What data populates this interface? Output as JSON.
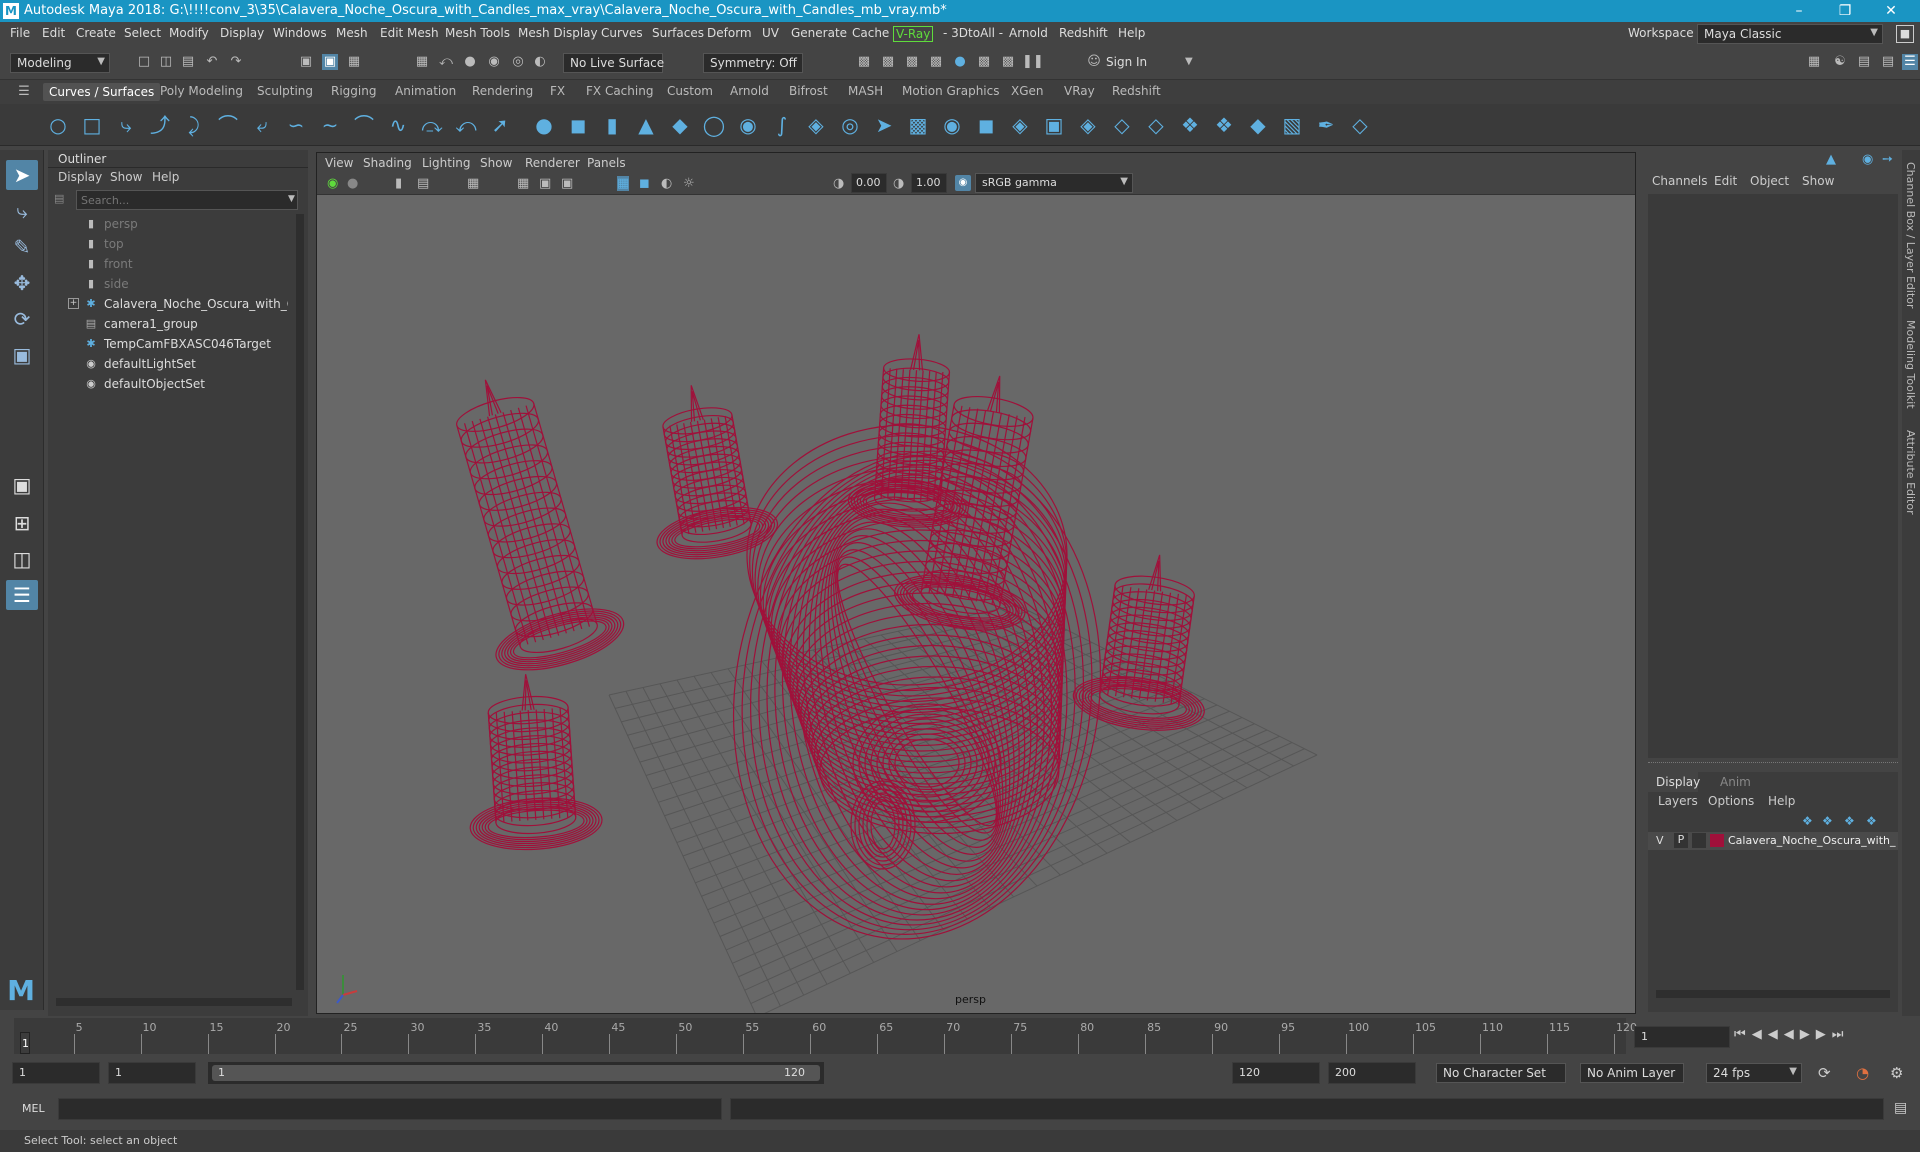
{
  "titlebar": {
    "title": "Autodesk Maya 2018: G:\\!!!!conv_3\\35\\Calavera_Noche_Oscura_with_Candles_max_vray\\Calavera_Noche_Oscura_with_Candles_mb_vray.mb*",
    "logo": "M"
  },
  "menubar": {
    "items": [
      "File",
      "Edit",
      "Create",
      "Select",
      "Modify",
      "Display",
      "Windows",
      "Mesh",
      "Edit Mesh",
      "Mesh Tools",
      "Mesh Display",
      "Curves",
      "Surfaces",
      "Deform",
      "UV",
      "Generate",
      "Cache",
      "V-Ray",
      "- 3DtoAll -",
      "Arnold",
      "Redshift",
      "Help"
    ],
    "workspace_label": "Workspace :",
    "workspace_value": "Maya Classic"
  },
  "toolbar": {
    "mode": "Modeling",
    "live_surface": "No Live Surface",
    "symmetry": "Symmetry: Off",
    "sign_in": "Sign In"
  },
  "shelf": {
    "tabs": [
      "Curves / Surfaces",
      "Poly Modeling",
      "Sculpting",
      "Rigging",
      "Animation",
      "Rendering",
      "FX",
      "FX Caching",
      "Custom",
      "Arnold",
      "Bifrost",
      "MASH",
      "Motion Graphics",
      "XGen",
      "VRay",
      "Redshift"
    ],
    "active_tab": "Curves / Surfaces"
  },
  "outliner": {
    "title": "Outliner",
    "menu": [
      "Display",
      "Show",
      "Help"
    ],
    "search_placeholder": "Search...",
    "items": [
      {
        "label": "persp",
        "dim": true,
        "icon": "camera-icon"
      },
      {
        "label": "top",
        "dim": true,
        "icon": "camera-icon"
      },
      {
        "label": "front",
        "dim": true,
        "icon": "camera-icon"
      },
      {
        "label": "side",
        "dim": true,
        "icon": "camera-icon"
      },
      {
        "label": "Calavera_Noche_Oscura_with_Candles",
        "dim": false,
        "icon": "transform-icon"
      },
      {
        "label": "camera1_group",
        "dim": false,
        "icon": "group-icon"
      },
      {
        "label": "TempCamFBXASC046Target",
        "dim": false,
        "icon": "transform-icon"
      },
      {
        "label": "defaultLightSet",
        "dim": false,
        "icon": "set-icon"
      },
      {
        "label": "defaultObjectSet",
        "dim": false,
        "icon": "set-icon"
      }
    ]
  },
  "viewport": {
    "menu": [
      "View",
      "Shading",
      "Lighting",
      "Show",
      "Renderer",
      "Panels"
    ],
    "exposure": "0.00",
    "gamma": "1.00",
    "color_space": "sRGB gamma",
    "camera_label": "persp",
    "wire_color": "#a0103a"
  },
  "channelbox": {
    "menu": [
      "Channels",
      "Edit",
      "Object",
      "Show"
    ],
    "side_tabs": [
      "Channel Box / Layer Editor",
      "Modeling Toolkit",
      "Attribute Editor"
    ]
  },
  "layers": {
    "tabs": [
      "Display",
      "Anim"
    ],
    "active_tab": "Display",
    "menu": [
      "Layers",
      "Options",
      "Help"
    ],
    "row": {
      "v": "V",
      "p": "P",
      "name": "Calavera_Noche_Oscura_with_",
      "color": "#a0103a"
    }
  },
  "timeline": {
    "ticks": [
      "1",
      "5",
      "10",
      "15",
      "20",
      "25",
      "30",
      "35",
      "40",
      "45",
      "50",
      "55",
      "60",
      "65",
      "70",
      "75",
      "80",
      "85",
      "90",
      "95",
      "100",
      "105",
      "110",
      "115",
      "120"
    ],
    "current_frame": "1"
  },
  "range": {
    "start": "1",
    "playback_start": "1",
    "slider_start": "1",
    "slider_end": "120",
    "playback_end": "120",
    "end": "200",
    "character_set": "No Character Set",
    "anim_layer": "No Anim Layer",
    "fps": "24 fps"
  },
  "mel": {
    "label": "MEL"
  },
  "help": {
    "text": "Select Tool: select an object"
  }
}
